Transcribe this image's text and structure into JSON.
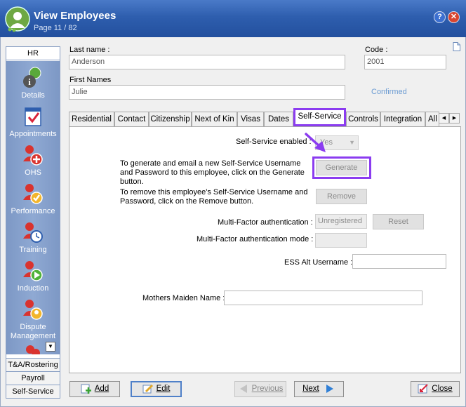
{
  "window": {
    "title": "View Employees",
    "subtitle": "Page 11 / 82",
    "help_label": "?",
    "close_label": "✕"
  },
  "sidebar": {
    "header": "HR",
    "items": [
      {
        "label": "Details",
        "icon": "person-info-icon"
      },
      {
        "label": "Appointments",
        "icon": "calendar-check-icon"
      },
      {
        "label": "OHS",
        "icon": "person-plus-icon"
      },
      {
        "label": "Performance",
        "icon": "person-check-icon"
      },
      {
        "label": "Training",
        "icon": "person-clock-icon"
      },
      {
        "label": "Induction",
        "icon": "person-play-icon"
      },
      {
        "label": "Dispute Management",
        "icon": "person-group-icon"
      }
    ],
    "scroll_label": "▼",
    "sections": [
      "T&A/Rostering",
      "Payroll",
      "Self-Service"
    ]
  },
  "header": {
    "last_name_label": "Last name :",
    "last_name_value": "Anderson",
    "first_names_label": "First Names",
    "first_names_value": "Julie",
    "code_label": "Code :",
    "code_value": "2001",
    "confirmed_text": "Confirmed"
  },
  "tabs": [
    "Residential",
    "Contact",
    "Citizenship",
    "Next of Kin",
    "Visas",
    "Dates",
    "Self-Service",
    "Controls",
    "Integration",
    "All"
  ],
  "active_tab": "Self-Service",
  "tab_arrows": [
    "◀",
    "▶"
  ],
  "self_service": {
    "enabled_label": "Self-Service enabled :",
    "enabled_value": "Yes",
    "generate_text": "To generate and email a new Self-Service Username and Password to this employee, click on the Generate button.",
    "generate_button": "Generate",
    "remove_text": "To remove this employee's Self-Service Username and Password, click on the Remove button.",
    "remove_button": "Remove",
    "mfa_label": "Multi-Factor authentication :",
    "mfa_value": "Unregistered",
    "reset_button": "Reset",
    "mfa_mode_label": "Multi-Factor authentication mode :",
    "mfa_mode_value": "",
    "ess_alt_label": "ESS Alt Username :",
    "ess_alt_value": "",
    "mothers_maiden_label": "Mothers Maiden Name :",
    "mothers_maiden_value": ""
  },
  "buttons": {
    "add": "Add",
    "edit": "Edit",
    "previous": "Previous",
    "next": "Next",
    "close": "Close"
  },
  "colors": {
    "title_bar": "#2e5eae",
    "sidebar": "#8fa9d3",
    "highlight": "#8b3cf0",
    "confirmed": "#6b9bd2"
  }
}
